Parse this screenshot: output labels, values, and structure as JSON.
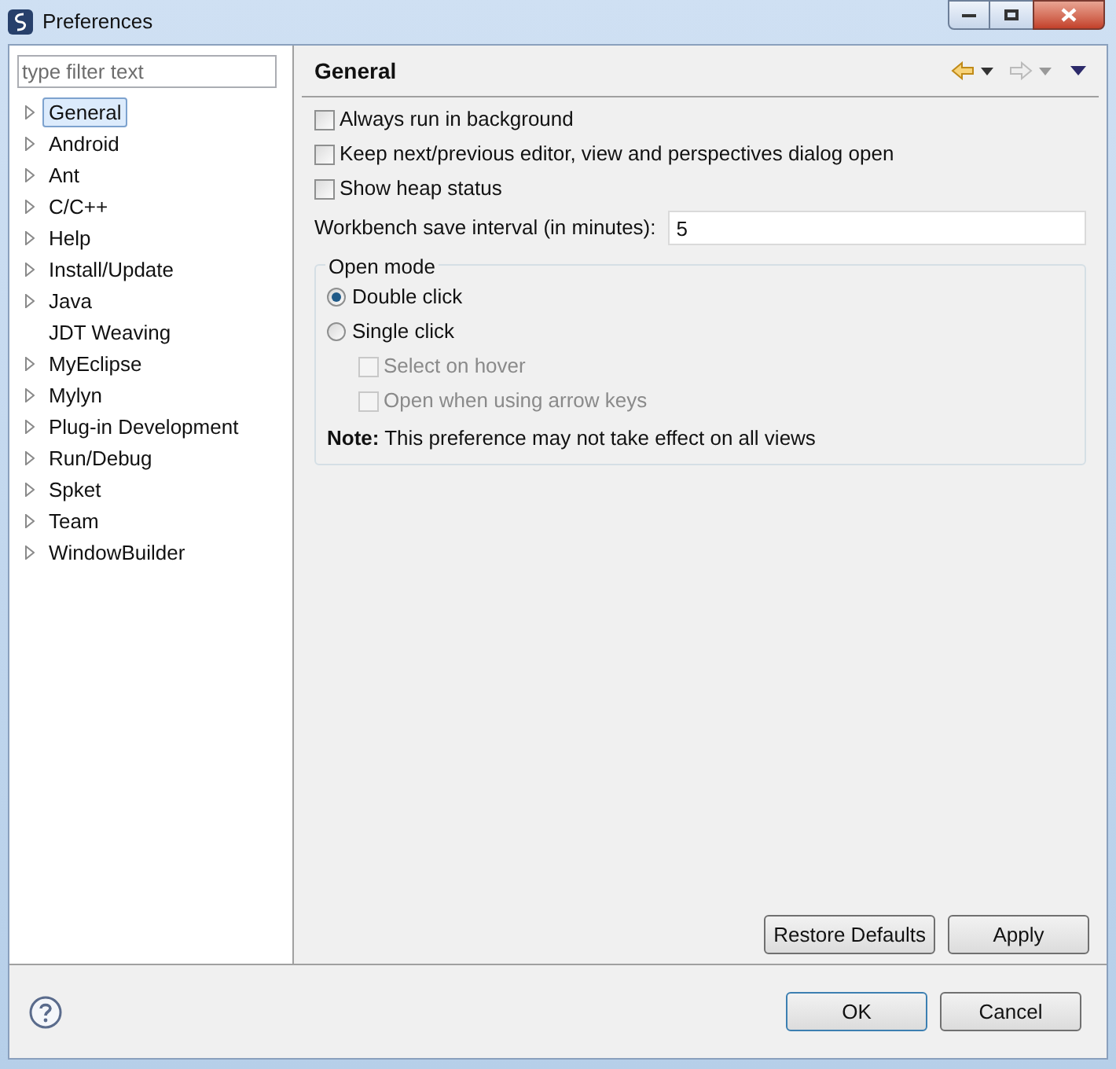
{
  "window": {
    "title": "Preferences"
  },
  "filter": {
    "placeholder": "type filter text"
  },
  "tree": [
    {
      "label": "General",
      "expandable": true,
      "selected": true
    },
    {
      "label": "Android",
      "expandable": true,
      "selected": false
    },
    {
      "label": "Ant",
      "expandable": true,
      "selected": false
    },
    {
      "label": "C/C++",
      "expandable": true,
      "selected": false
    },
    {
      "label": "Help",
      "expandable": true,
      "selected": false
    },
    {
      "label": "Install/Update",
      "expandable": true,
      "selected": false
    },
    {
      "label": "Java",
      "expandable": true,
      "selected": false
    },
    {
      "label": "JDT Weaving",
      "expandable": false,
      "selected": false
    },
    {
      "label": "MyEclipse",
      "expandable": true,
      "selected": false
    },
    {
      "label": "Mylyn",
      "expandable": true,
      "selected": false
    },
    {
      "label": "Plug-in Development",
      "expandable": true,
      "selected": false
    },
    {
      "label": "Run/Debug",
      "expandable": true,
      "selected": false
    },
    {
      "label": "Spket",
      "expandable": true,
      "selected": false
    },
    {
      "label": "Team",
      "expandable": true,
      "selected": false
    },
    {
      "label": "WindowBuilder",
      "expandable": true,
      "selected": false
    }
  ],
  "page": {
    "title": "General",
    "options": [
      {
        "label": "Always run in background",
        "checked": false
      },
      {
        "label": "Keep next/previous editor, view and perspectives dialog open",
        "checked": false
      },
      {
        "label": "Show heap status",
        "checked": false
      }
    ],
    "save_interval": {
      "label": "Workbench save interval (in minutes):",
      "value": "5"
    },
    "open_mode": {
      "title": "Open mode",
      "choices": [
        {
          "label": "Double click",
          "selected": true
        },
        {
          "label": "Single click",
          "selected": false
        }
      ],
      "sub_options": [
        {
          "label": "Select on hover",
          "checked": false,
          "disabled": true
        },
        {
          "label": "Open when using arrow keys",
          "checked": false,
          "disabled": true
        }
      ],
      "note": "**Note:** This preference may not take effect on all views"
    },
    "buttons": [
      "Restore Defaults",
      "Apply"
    ]
  },
  "dialog_buttons": [
    {
      "label": "OK",
      "default": true
    },
    {
      "label": "Cancel",
      "default": false
    }
  ]
}
